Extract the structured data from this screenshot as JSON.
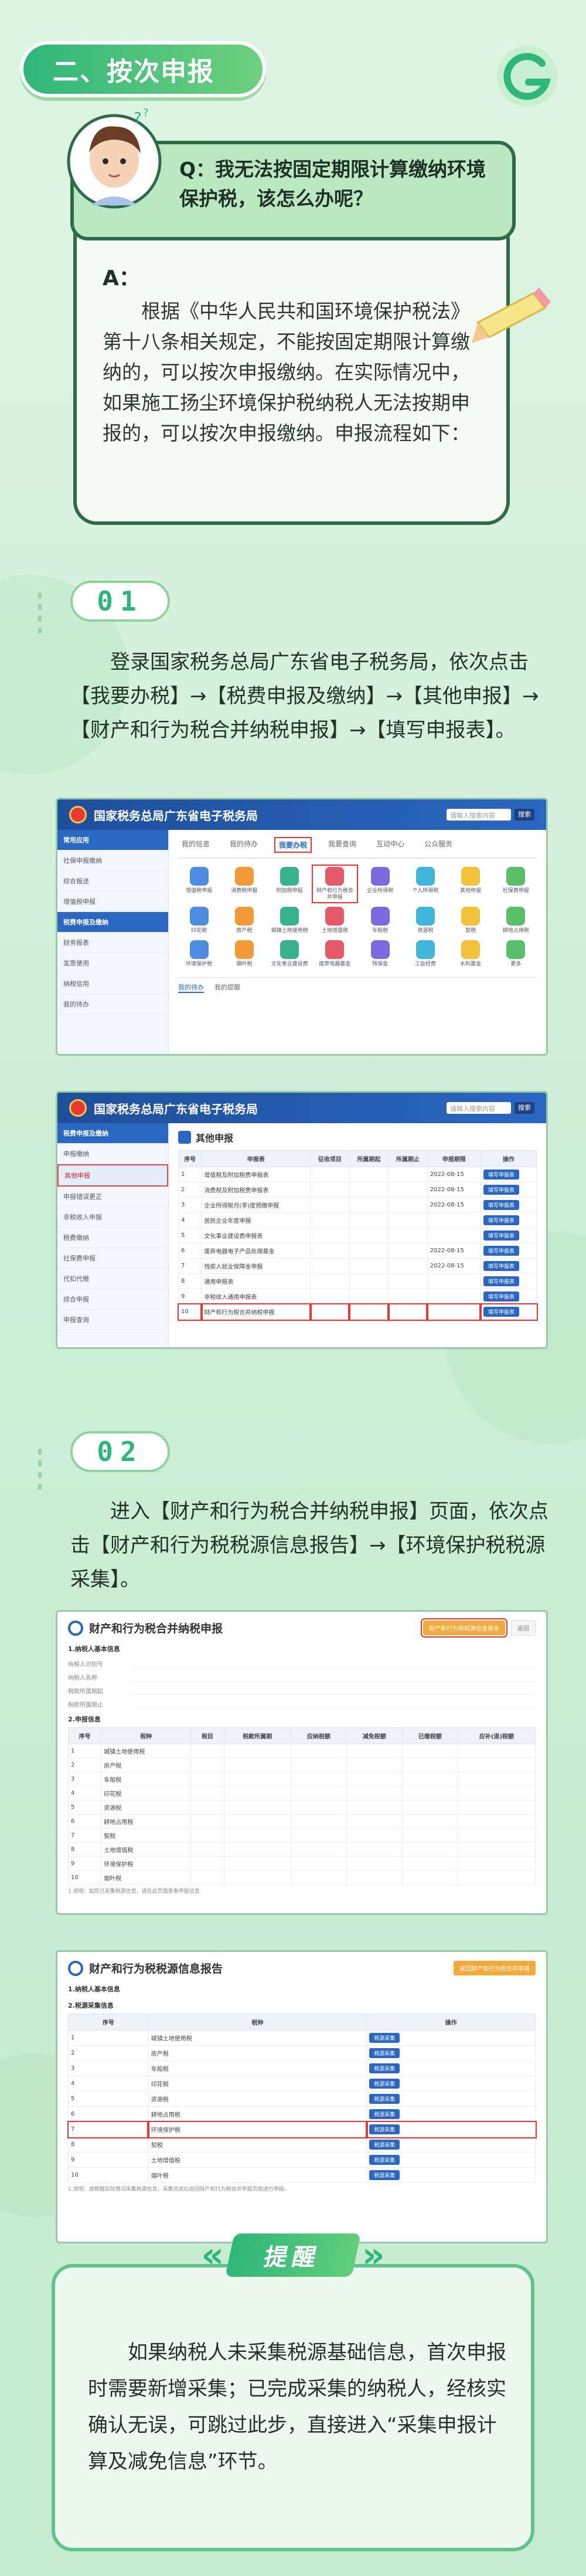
{
  "section": {
    "title": "二、按次申报"
  },
  "qa": {
    "question": "Q：我无法按固定期限计算缴纳环境保护税，该怎么办呢？",
    "answer_label": "A：",
    "answer": "根据《中华人民共和国环境保护税法》第十八条相关规定，不能按固定期限计算缴纳的，可以按次申报缴纳。在实际情况中，如果施工扬尘环境保护税纳税人无法按期申报的，可以按次申报缴纳。申报流程如下："
  },
  "step1": {
    "num": "01",
    "text": "登录国家税务总局广东省电子税务局，依次点击【我要办税】→【税费申报及缴纳】→【其他申报】→【财产和行为税合并纳税申报】→【填写申报表】。"
  },
  "step2": {
    "num": "02",
    "text": "进入【财产和行为税合并纳税申报】页面，依次点击【财产和行为税税源信息报告】→【环境保护税税源采集】。"
  },
  "portal": {
    "title": "国家税务总局广东省电子税务局",
    "search_placeholder": "请输入搜索内容",
    "search_btn": "搜索",
    "tabs": [
      "我的信息",
      "我的待办",
      "我要办税",
      "我要查询",
      "互动中心",
      "公众服务"
    ],
    "selected_tab": 2,
    "side": [
      "常用应用",
      "社保申报缴纳",
      "综合报送",
      "增值税申报",
      "税费申报及缴纳",
      "财务报表",
      "发票使用",
      "纳税信用",
      "我的待办"
    ],
    "icons": [
      "增值税申报",
      "消费税申报",
      "附加税申报",
      "财产和行为税合并申报",
      "企业所得税",
      "个人所得税",
      "其他申报",
      "社保费申报",
      "印花税",
      "房产税",
      "城镇土地使用税",
      "土地增值税",
      "车船税",
      "资源税",
      "契税",
      "耕地占用税",
      "环境保护税",
      "烟叶税",
      "文化事业建设费",
      "废弃电器基金",
      "残保金",
      "工会经费",
      "水利基金",
      "更多"
    ],
    "highlight_icon": 3,
    "sub_tabs": [
      "我的待办",
      "我的提醒"
    ]
  },
  "other_report": {
    "title": "其他申报",
    "side": [
      "税费申报及缴纳",
      "申报缴纳",
      "其他申报",
      "申报错误更正",
      "非税收入申报",
      "税费缴纳",
      "社保费申报",
      "代扣代缴",
      "综合申报",
      "申报查询"
    ],
    "active_side": 2,
    "columns": [
      "序号",
      "申报表",
      "征收项目",
      "所属期起",
      "所属期止",
      "申报期限",
      "操作"
    ],
    "rows": [
      [
        "1",
        "增值税及附加税费申报表",
        "",
        "",
        "",
        "2022-08-15",
        "填写申报表"
      ],
      [
        "2",
        "消费税及附加税费申报表",
        "",
        "",
        "",
        "2022-08-15",
        "填写申报表"
      ],
      [
        "3",
        "企业所得税月(季)度预缴申报",
        "",
        "",
        "",
        "2022-08-15",
        "填写申报表"
      ],
      [
        "4",
        "居民企业年度申报",
        "",
        "",
        "",
        "",
        "填写申报表"
      ],
      [
        "5",
        "文化事业建设费申报表",
        "",
        "",
        "",
        "",
        "填写申报表"
      ],
      [
        "6",
        "废弃电器电子产品处理基金",
        "",
        "",
        "",
        "2022-08-15",
        "填写申报表"
      ],
      [
        "7",
        "残疾人就业保障金申报",
        "",
        "",
        "",
        "2022-08-15",
        "填写申报表"
      ],
      [
        "8",
        "通用申报表",
        "",
        "",
        "",
        "",
        "填写申报表"
      ],
      [
        "9",
        "非税收入通用申报表",
        "",
        "",
        "",
        "",
        "填写申报表"
      ],
      [
        "10",
        "财产和行为税合并纳税申报",
        "",
        "",
        "",
        "",
        "填写申报表"
      ]
    ],
    "highlight_row": 9
  },
  "merge_form": {
    "title": "财产和行为税合并纳税申报",
    "btn_primary": "财产和行为税税源信息报告",
    "btn_secondary": "返回",
    "sec1": "1.纳税人基本信息",
    "fields": [
      "纳税人识别号",
      "纳税人名称",
      "税款所属期起",
      "税款所属期止"
    ],
    "sec2": "2.申报信息",
    "columns": [
      "序号",
      "税种",
      "税目",
      "税款所属期",
      "应纳税额",
      "减免税额",
      "已缴税额",
      "应补(退)税额"
    ],
    "taxes": [
      "城镇土地使用税",
      "房产税",
      "车船税",
      "印花税",
      "资源税",
      "耕地占用税",
      "契税",
      "土地增值税",
      "环境保护税",
      "烟叶税"
    ],
    "notes": "1.说明：如您已采集税源信息，请在此页面查看申报信息"
  },
  "source_form": {
    "title": "财产和行为税税源信息报告",
    "btn_primary": "返回财产和行为税合并申报",
    "sec1": "1.纳税人基本信息",
    "sec2": "2.税源采集信息",
    "columns": [
      "序号",
      "税种",
      "操作"
    ],
    "taxes": [
      "城镇土地使用税",
      "房产税",
      "车船税",
      "印花税",
      "资源税",
      "耕地占用税",
      "环境保护税",
      "契税",
      "土地增值税",
      "烟叶税"
    ],
    "op": "税源采集",
    "highlight_row": 6,
    "notes": "1.说明：请根据实际情况采集税源信息，采集完成后返回财产和行为税合并申报页面进行申报。"
  },
  "reminder": {
    "badge": "提醒",
    "text": "如果纳税人未采集税源基础信息，首次申报时需要新增采集；已完成采集的纳税人，经核实确认无误，可跳过此步，直接进入“采集申报计算及减免信息”环节。"
  },
  "colors": {
    "green": "#2fb67a",
    "dark": "#2f6b4a",
    "portal_blue": "#2a67c2",
    "highlight": "#e33333"
  }
}
